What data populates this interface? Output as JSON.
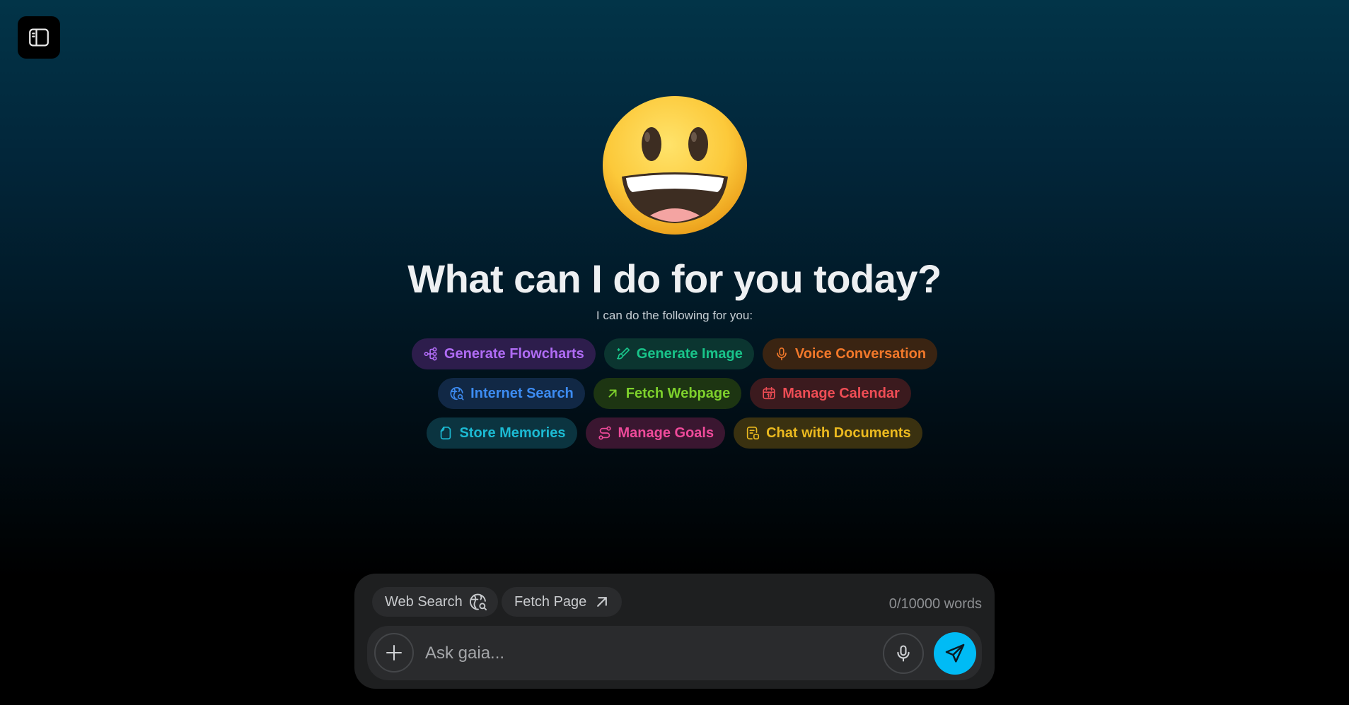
{
  "sidebar": {
    "toggle_icon": "sidebar-panel-icon"
  },
  "hero": {
    "emoji_icon": "grinning-face-icon",
    "title": "What can I do for you today?",
    "subtitle": "I can do the following for you:"
  },
  "capabilities": {
    "row1": [
      {
        "label": "Generate Flowcharts",
        "icon": "flowchart-icon",
        "color": "#b06cf5"
      },
      {
        "label": "Generate Image",
        "icon": "brush-icon",
        "color": "#19c48a"
      },
      {
        "label": "Voice Conversation",
        "icon": "microphone-icon",
        "color": "#f2782a"
      }
    ],
    "row2": [
      {
        "label": "Internet Search",
        "icon": "globe-search-icon",
        "color": "#3d8cf2"
      },
      {
        "label": "Fetch Webpage",
        "icon": "arrow-up-right-icon",
        "color": "#7ed12c"
      },
      {
        "label": "Manage Calendar",
        "icon": "calendar-icon",
        "color": "#ef4d55"
      }
    ],
    "row3": [
      {
        "label": "Store Memories",
        "icon": "memory-icon",
        "color": "#1cbad3"
      },
      {
        "label": "Manage Goals",
        "icon": "route-icon",
        "color": "#ee4a9a"
      },
      {
        "label": "Chat with Documents",
        "icon": "document-icon",
        "color": "#ecba1f"
      }
    ]
  },
  "composer": {
    "web_search_label": "Web Search",
    "fetch_page_label": "Fetch Page",
    "word_count": "0/10000 words",
    "placeholder": "Ask gaia...",
    "input_value": "",
    "send_color": "#00bbf5"
  }
}
